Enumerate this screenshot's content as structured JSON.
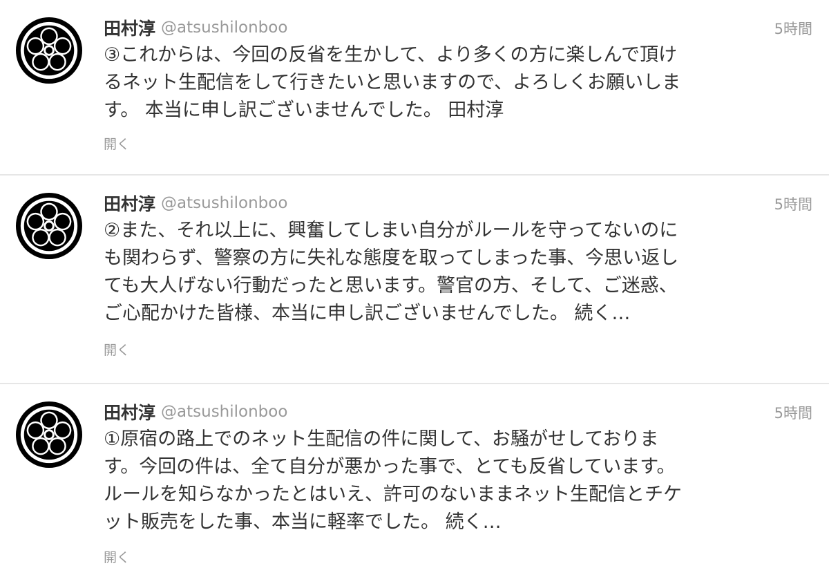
{
  "tweets": [
    {
      "name": "田村淳",
      "handle": "@atsushilonboo",
      "time": "5時間",
      "lines": [
        "③これからは、今回の反省を生かして、より多くの方に楽しんで頂け",
        "るネット生配信をして行きたいと思いますので、よろしくお願いしま",
        "す。 本当に申し訳ございませんでした。 田村淳"
      ],
      "expand": "開く"
    },
    {
      "name": "田村淳",
      "handle": "@atsushilonboo",
      "time": "5時間",
      "lines": [
        "②また、それ以上に、興奮してしまい自分がルールを守ってないのに",
        "も関わらず、警察の方に失礼な態度を取ってしまった事、今思い返し",
        "ても大人げない行動だったと思います。警官の方、そして、ご迷惑、",
        "ご心配かけた皆様、本当に申し訳ございませんでした。 続く…"
      ],
      "expand": "開く"
    },
    {
      "name": "田村淳",
      "handle": "@atsushilonboo",
      "time": "5時間",
      "lines": [
        "①原宿の路上でのネット生配信の件に関して、お騒がせしておりま",
        "す。今回の件は、全て自分が悪かった事で、とても反省しています。",
        "ルールを知らなかったとはいえ、許可のないままネット生配信とチケ",
        "ット販売をした事、本当に軽率でした。 続く…"
      ],
      "expand": "開く"
    }
  ],
  "avatar_icon": "plum-blossom-crest-icon",
  "colors": {
    "text": "#333333",
    "muted": "#999999",
    "divider": "#e6e6e6",
    "crest": "#000000"
  }
}
